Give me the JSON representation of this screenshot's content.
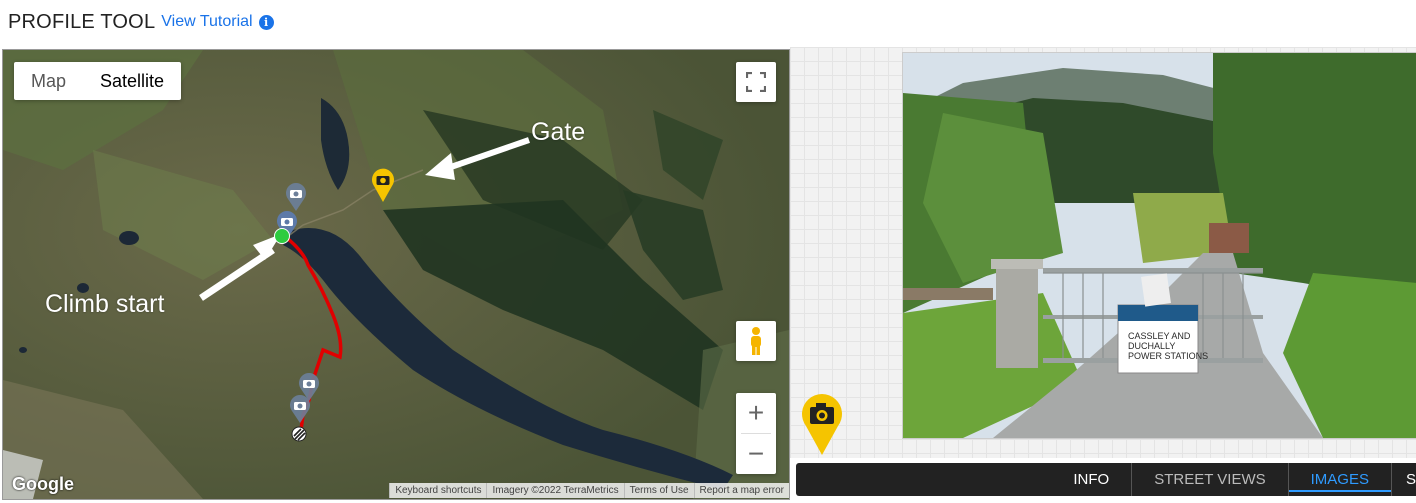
{
  "header": {
    "title": "PROFILE TOOL",
    "tutorial_link": "View Tutorial",
    "info_icon": "info-icon"
  },
  "map": {
    "type_buttons": {
      "map": "Map",
      "satellite": "Satellite",
      "selected": "Satellite"
    },
    "labels": {
      "gate": "Gate",
      "climb_start": "Climb start"
    },
    "logo": "Google",
    "attribution": [
      "Keyboard shortcuts",
      "Imagery ©2022 TerraMetrics",
      "Terms of Use",
      "Report a map error"
    ],
    "controls": {
      "fullscreen": "fullscreen-icon",
      "pegman": "pegman-icon",
      "zoom_in": "+",
      "zoom_out": "−"
    },
    "colors": {
      "route": "#e00000",
      "start_marker": "#2ecc40",
      "camera_pin": "#f5c400"
    }
  },
  "tabs": {
    "items": [
      "INFO",
      "STREET VIEWS",
      "IMAGES",
      "S"
    ],
    "active": "IMAGES"
  },
  "photo_sign": {
    "line1": "CASSLEY AND",
    "line2": "DUCHALLY",
    "line3": "POWER STATIONS"
  }
}
